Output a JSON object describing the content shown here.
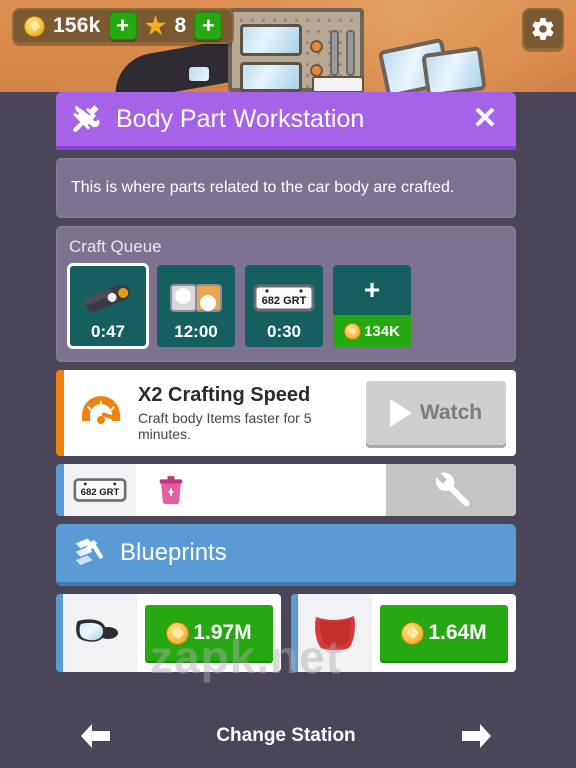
{
  "hud": {
    "coin_icon": "coin-icon",
    "coins": "156k",
    "add_coins_label": "+",
    "star_icon": "star-icon",
    "stars": "8",
    "add_stars_label": "+",
    "settings_icon": "gear-icon"
  },
  "modal": {
    "icon": "hammer-wrench-icon",
    "title": "Body Part Workstation",
    "close_label": "✕",
    "description": "This is where parts related to the car body are crafted."
  },
  "queue": {
    "label": "Craft Queue",
    "slots": [
      {
        "icon": "car-handle-part-icon",
        "time": "0:47",
        "selected": true
      },
      {
        "icon": "headlight-part-icon",
        "time": "12:00",
        "selected": false
      },
      {
        "icon": "license-plate-icon",
        "time": "0:30",
        "selected": false
      }
    ],
    "add_slot": {
      "plus_label": "+",
      "price": "134K",
      "coin_icon": "coin-icon"
    }
  },
  "boost": {
    "icon": "speedometer-icon",
    "title": "X2 Crafting Speed",
    "subtitle": "Craft body Items faster for 5 minutes.",
    "button_label": "Watch",
    "play_icon": "play-icon",
    "accent_color": "#f08010"
  },
  "crafted_row": {
    "item_icon": "license-plate-icon",
    "recycle_icon": "recycle-bin-icon",
    "action_icon": "wrench-icon",
    "plate_text": "682 GRT"
  },
  "blueprints": {
    "icon": "blueprint-icon",
    "title": "Blueprints",
    "cards": [
      {
        "icon": "side-mirror-icon",
        "price": "1.97M",
        "coin_icon": "coin-icon"
      },
      {
        "icon": "red-body-panel-icon",
        "price": "1.64M",
        "coin_icon": "coin-icon"
      }
    ]
  },
  "footer": {
    "prev_icon": "arrow-left-icon",
    "label": "Change Station",
    "next_icon": "arrow-right-icon"
  },
  "scene": {
    "plate_text": "682 GRT"
  },
  "watermark": "zapk.net",
  "colors": {
    "header_purple": "#a663e8",
    "panel_purple": "#7d7290",
    "queue_teal": "#15605f",
    "green": "#25a811",
    "blue": "#5b9bd5",
    "orange": "#f08010",
    "background": "#4a4557"
  }
}
